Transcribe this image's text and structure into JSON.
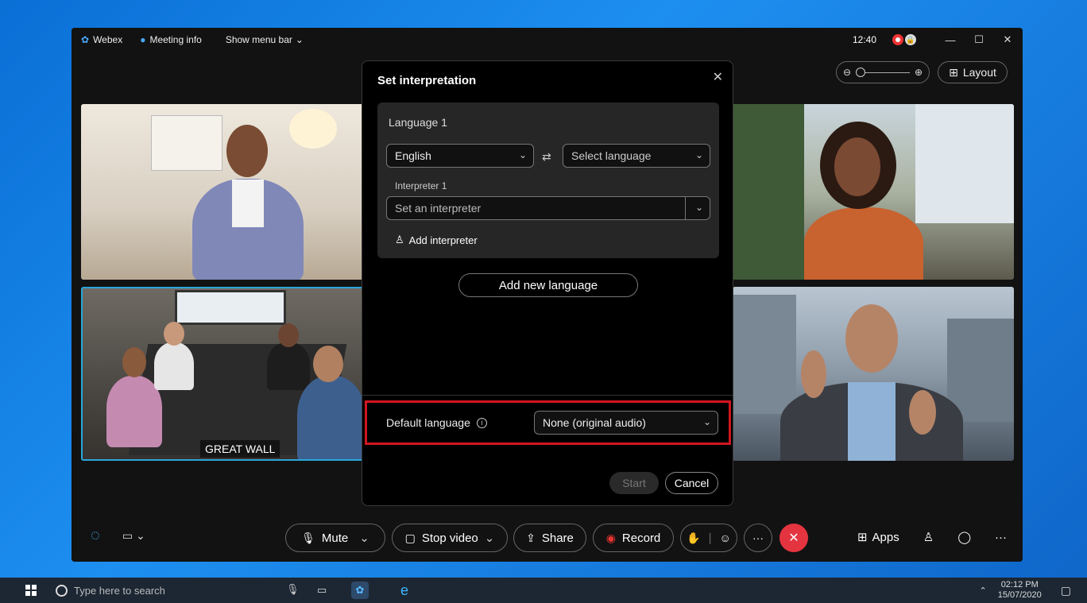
{
  "titlebar": {
    "app_name": "Webex",
    "meeting_info": "Meeting info",
    "show_menu_bar": "Show menu bar",
    "time": "12:40"
  },
  "stage": {
    "layout_label": "Layout",
    "tile_label": "GREAT WALL"
  },
  "dialog": {
    "title": "Set interpretation",
    "language_title": "Language 1",
    "source_language": "English",
    "target_language_placeholder": "Select language",
    "interpreter_label": "Interpreter 1",
    "interpreter_placeholder": "Set an interpreter",
    "add_interpreter": "Add interpreter",
    "add_new_language": "Add new language",
    "default_language_label": "Default language",
    "default_language_value": "None (original audio)",
    "start_label": "Start",
    "cancel_label": "Cancel",
    "highlight_color": "#d0161f"
  },
  "controls": {
    "mute": "Mute",
    "stop_video": "Stop video",
    "share": "Share",
    "record": "Record",
    "apps": "Apps"
  },
  "taskbar": {
    "search_placeholder": "Type here to search",
    "clock_time": "02:12 PM",
    "clock_date": "15/07/2020"
  }
}
